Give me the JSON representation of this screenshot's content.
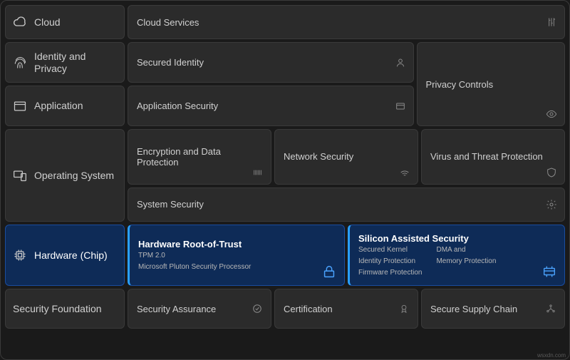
{
  "rows": {
    "cloud": {
      "label": "Cloud",
      "cards": {
        "services": "Cloud Services"
      }
    },
    "identity": {
      "label": "Identity and Privacy",
      "cards": {
        "secured_identity": "Secured Identity"
      }
    },
    "application": {
      "label": "Application",
      "cards": {
        "app_security": "Application Security"
      }
    },
    "privacy_controls": "Privacy Controls",
    "os": {
      "label": "Operating System",
      "cards": {
        "encryption": "Encryption and Data Protection",
        "network": "Network Security",
        "virus": "Virus and Threat Protection",
        "system": "System Security"
      }
    },
    "hardware": {
      "label": "Hardware (Chip)",
      "root_of_trust": {
        "title": "Hardware Root-of-Trust",
        "line1": "TPM 2.0",
        "line2": "Microsoft Pluton Security Processor"
      },
      "silicon": {
        "title": "Silicon Assisted Security",
        "col1_l1": "Secured Kernel",
        "col1_l2": "Identity Protection",
        "col1_l3": "Firmware Protection",
        "col2_l1": "DMA and",
        "col2_l2": "Memory Protection"
      }
    },
    "foundation": {
      "label": "Security Foundation",
      "cards": {
        "assurance": "Security Assurance",
        "certification": "Certification",
        "supply": "Secure Supply Chain"
      }
    }
  },
  "watermark": "wsxdn.com"
}
